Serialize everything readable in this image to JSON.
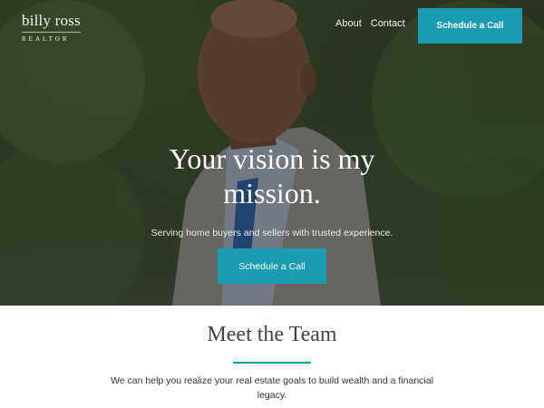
{
  "brand": {
    "name": "billy ross",
    "subtitle": "REALTOR"
  },
  "nav": {
    "items": [
      {
        "label": "About"
      },
      {
        "label": "Contact"
      }
    ],
    "cta_label": "Schedule a Call"
  },
  "hero": {
    "headline": "Your vision is my mission.",
    "tagline": "Serving home buyers and sellers with trusted experience.",
    "cta_label": "Schedule a Call",
    "image": "portrait-photo"
  },
  "team": {
    "title": "Meet the Team",
    "description": "We can help you realize your real estate goals to build wealth and a financial legacy."
  },
  "colors": {
    "accent": "#1c9cb0",
    "heading": "#444444",
    "text": "#333333"
  }
}
